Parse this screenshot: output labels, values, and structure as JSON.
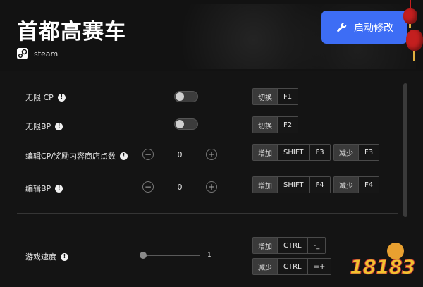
{
  "app": {
    "title": "首都高赛车",
    "platform": "steam",
    "launch_button": "启动修改"
  },
  "rows": [
    {
      "label": "无限 CP",
      "control": "toggle",
      "keys": [
        {
          "action": "切换",
          "keys": [
            "F1"
          ]
        }
      ]
    },
    {
      "label": "无限BP",
      "control": "toggle",
      "keys": [
        {
          "action": "切换",
          "keys": [
            "F2"
          ]
        }
      ]
    },
    {
      "label": "编辑CP/奖励内容商店点数",
      "control": "stepper",
      "value": "0",
      "keys": [
        {
          "action": "增加",
          "keys": [
            "SHIFT",
            "F3"
          ]
        },
        {
          "action": "减少",
          "keys": [
            "F3"
          ]
        }
      ]
    },
    {
      "label": "编辑BP",
      "control": "stepper",
      "value": "0",
      "keys": [
        {
          "action": "增加",
          "keys": [
            "SHIFT",
            "F4"
          ]
        },
        {
          "action": "减少",
          "keys": [
            "F4"
          ]
        }
      ]
    },
    {
      "label": "游戏速度",
      "control": "slider",
      "value": "1",
      "slider_fraction": 0,
      "keys": [
        {
          "action": "增加",
          "keys": [
            "CTRL",
            "-_"
          ]
        },
        {
          "action": "减少",
          "keys": [
            "CTRL",
            "=+"
          ]
        }
      ]
    }
  ],
  "symbols": {
    "info": "!",
    "minus": "−",
    "plus": "+"
  },
  "watermark": "18183",
  "icons": {
    "platform": "steam-icon",
    "launch": "wrench-icon",
    "info": "info-icon"
  },
  "colors": {
    "accent": "#3d6df5",
    "background": "#141414",
    "lantern": "#c41f1f"
  }
}
